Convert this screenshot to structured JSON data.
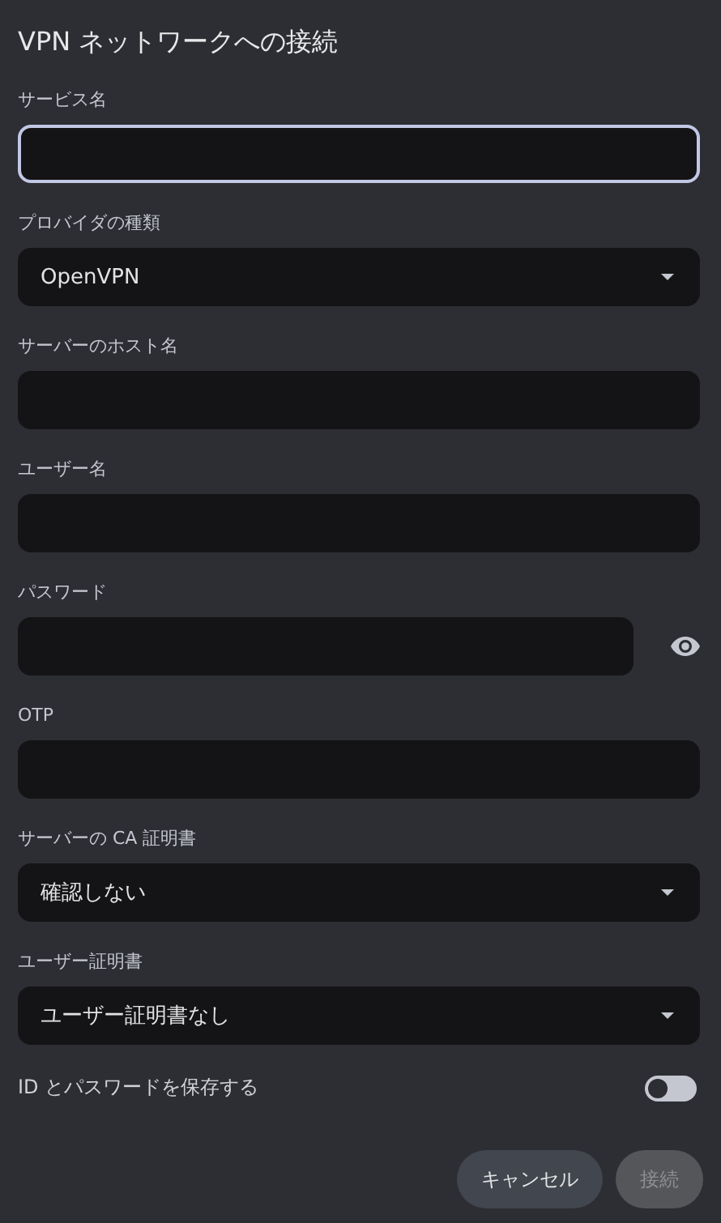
{
  "window": {
    "title": "VPN ネットワークへの接続"
  },
  "fields": [
    {
      "kind": "text",
      "label": "サービス名",
      "focused": true
    },
    {
      "kind": "select",
      "label": "プロバイダの種類",
      "value": "OpenVPN",
      "focused": false
    },
    {
      "kind": "text",
      "label": "サーバーのホスト名",
      "focused": false
    },
    {
      "kind": "text",
      "label": "ユーザー名",
      "focused": false
    },
    {
      "kind": "password",
      "label": "パスワード",
      "focused": false
    },
    {
      "kind": "text",
      "label": "OTP",
      "focused": false
    },
    {
      "kind": "select",
      "label": "サーバーの CA 証明書",
      "value": "確認しない",
      "focused": false
    },
    {
      "kind": "select",
      "label": "ユーザー証明書",
      "value": "ユーザー証明書なし",
      "focused": false
    }
  ],
  "save_toggle": {
    "label": "ID とパスワードを保存する",
    "on": false
  },
  "buttons": [
    {
      "label": "キャンセル",
      "disabled": false
    },
    {
      "label": "接続",
      "disabled": true
    }
  ]
}
